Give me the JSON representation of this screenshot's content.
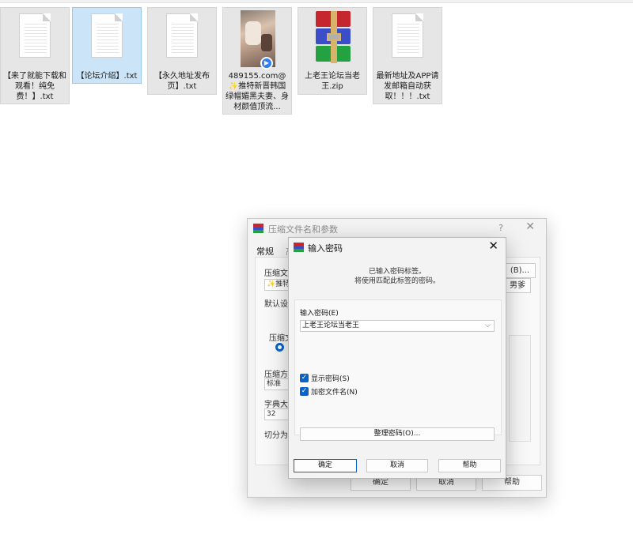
{
  "desktop": {
    "files": [
      {
        "name": "【来了就能下载和观看！纯免费！】.txt",
        "icon": "text-file-icon"
      },
      {
        "name": "【论坛介绍】.txt",
        "icon": "text-file-icon"
      },
      {
        "name": "【永久地址发布页】.txt",
        "icon": "text-file-icon"
      },
      {
        "name": "489155.com@✨推特新晋韩国绿帽媚黑夫妻、身材颜值顶流...",
        "icon": "video-thumbnail"
      },
      {
        "name": "上老王论坛当老王.zip",
        "icon": "winrar-archive-icon"
      },
      {
        "name": "最新地址及APP请发邮箱自动获取！！！.txt",
        "icon": "text-file-icon"
      }
    ]
  },
  "archive_dialog": {
    "title": "压缩文件名和参数",
    "help": "?",
    "tabs": [
      "常规",
      "高"
    ],
    "archive_name_label": "压缩文件名",
    "archive_name_value": "✨推特",
    "browse_button": "(B)...",
    "profile_value": "男爹",
    "defaults_label": "默认设置",
    "format_label": "压缩文件",
    "method_label": "压缩方式",
    "method_value": "标准",
    "dict_label": "字典大小",
    "dict_value": "32",
    "split_label": "切分为分卷",
    "ok": "确定",
    "cancel": "取消",
    "help_button": "帮助"
  },
  "password_dialog": {
    "title": "输入密码",
    "message_line1": "已输入密码标签。",
    "message_line2": "将使用匹配此标签的密码。",
    "password_label": "输入密码(E)",
    "password_value": "上老王论坛当老王",
    "show_password": "显示密码(S)",
    "encrypt_filenames": "加密文件名(N)",
    "organize_button": "整理密码(O)...",
    "ok": "确定",
    "cancel": "取消",
    "help": "帮助"
  },
  "colors": {
    "accent": "#0a64c8",
    "selection": "#cce4f7",
    "dialog_bg": "#f3f3f3"
  }
}
